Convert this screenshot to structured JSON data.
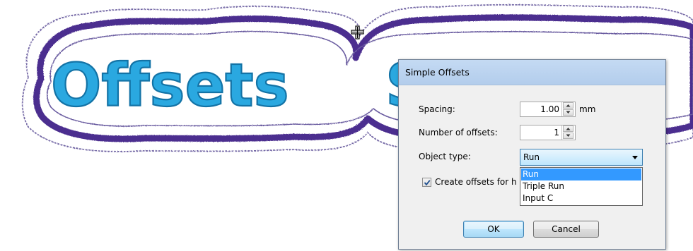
{
  "canvas": {
    "artwork_text": "Offsets Stitches",
    "colors": {
      "letter_fill": "#2aa8e0",
      "letter_stroke": "#1373a6",
      "offset_inner": "#4b2d8f",
      "offset_outer": "#7266a4"
    },
    "cursor_icon": "crosshair-move-icon"
  },
  "dialog": {
    "title": "Simple Offsets",
    "spacing": {
      "label": "Spacing:",
      "value": "1.00",
      "unit": "mm"
    },
    "num_offsets": {
      "label": "Number of offsets:",
      "value": "1"
    },
    "object_type": {
      "label": "Object type:",
      "selected": "Run",
      "options": [
        "Run",
        "Triple Run",
        "Input C"
      ]
    },
    "create_offsets": {
      "label": "Create offsets for h",
      "checked": true
    },
    "ok_label": "OK",
    "cancel_label": "Cancel"
  }
}
